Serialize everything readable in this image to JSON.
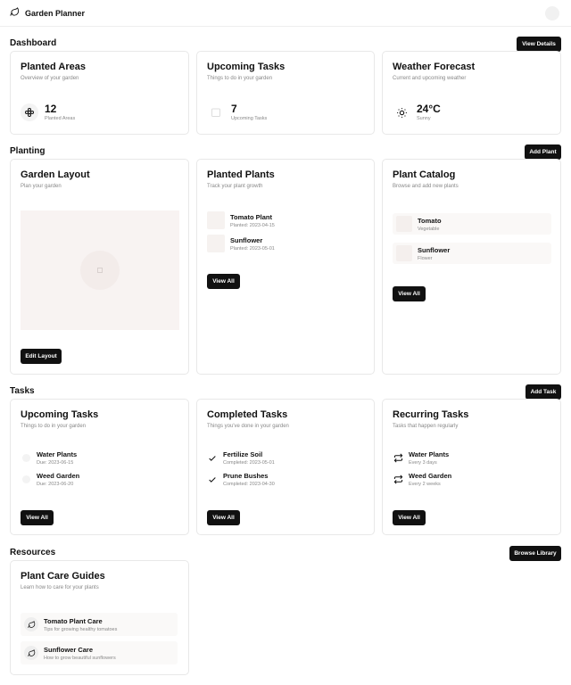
{
  "header": {
    "app_title": "Garden Planner",
    "logo_icon": "leaf-icon"
  },
  "dashboard": {
    "title": "Dashboard",
    "view_details": "View Details",
    "planted_areas": {
      "title": "Planted Areas",
      "subtitle": "Overview of your garden",
      "value": "12",
      "label": "Planted Areas",
      "icon": "flower-icon"
    },
    "upcoming_tasks": {
      "title": "Upcoming Tasks",
      "subtitle": "Things to do in your garden",
      "value": "7",
      "label": "Upcoming Tasks",
      "icon": "calendar-icon"
    },
    "weather": {
      "title": "Weather Forecast",
      "subtitle": "Current and upcoming weather",
      "value": "24°C",
      "label": "Sunny",
      "icon": "sun-icon"
    }
  },
  "planting": {
    "title": "Planting",
    "add_plant": "Add Plant",
    "garden_layout": {
      "title": "Garden Layout",
      "subtitle": "Plan your garden",
      "button": "Edit Layout"
    },
    "planted_plants": {
      "title": "Planted Plants",
      "subtitle": "Track your plant growth",
      "items": [
        {
          "name": "Tomato Plant",
          "detail": "Planted: 2023-04-15"
        },
        {
          "name": "Sunflower",
          "detail": "Planted: 2023-05-01"
        }
      ],
      "button": "View All"
    },
    "catalog": {
      "title": "Plant Catalog",
      "subtitle": "Browse and add new plants",
      "items": [
        {
          "name": "Tomato",
          "detail": "Vegetable"
        },
        {
          "name": "Sunflower",
          "detail": "Flower"
        }
      ],
      "button": "View All"
    }
  },
  "tasks": {
    "title": "Tasks",
    "add_task": "Add Task",
    "upcoming": {
      "title": "Upcoming Tasks",
      "subtitle": "Things to do in your garden",
      "items": [
        {
          "name": "Water Plants",
          "detail": "Due: 2023-06-15"
        },
        {
          "name": "Weed Garden",
          "detail": "Due: 2023-06-20"
        }
      ],
      "button": "View All"
    },
    "completed": {
      "title": "Completed Tasks",
      "subtitle": "Things you've done in your garden",
      "items": [
        {
          "name": "Fertilize Soil",
          "detail": "Completed: 2023-05-01"
        },
        {
          "name": "Prune Bushes",
          "detail": "Completed: 2023-04-30"
        }
      ],
      "button": "View All"
    },
    "recurring": {
      "title": "Recurring Tasks",
      "subtitle": "Tasks that happen regularly",
      "items": [
        {
          "name": "Water Plants",
          "detail": "Every 3 days"
        },
        {
          "name": "Weed Garden",
          "detail": "Every 2 weeks"
        }
      ],
      "button": "View All"
    }
  },
  "resources": {
    "title": "Resources",
    "browse_library": "Browse Library",
    "guides": {
      "title": "Plant Care Guides",
      "subtitle": "Learn how to care for your plants",
      "items": [
        {
          "name": "Tomato Plant Care",
          "detail": "Tips for growing healthy tomatoes"
        },
        {
          "name": "Sunflower Care",
          "detail": "How to grow beautiful sunflowers"
        }
      ]
    }
  }
}
